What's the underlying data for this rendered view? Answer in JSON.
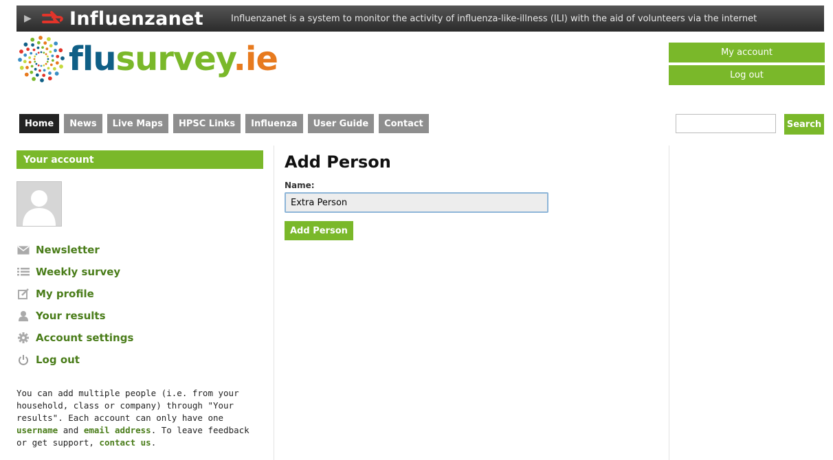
{
  "influenzanet_bar": {
    "title": "Influenzanet",
    "tagline": "Influenzanet is a system to monitor the activity of influenza-like-illness (ILI) with the aid of volunteers via the internet"
  },
  "logo": {
    "part1": "flu",
    "part2": "survey",
    "part3": ".ie"
  },
  "account_buttons": {
    "my_account": "My account",
    "log_out": "Log out"
  },
  "nav": {
    "items": [
      "Home",
      "News",
      "Live Maps",
      "HPSC Links",
      "Influenza",
      "User Guide",
      "Contact"
    ],
    "active": "Home"
  },
  "search": {
    "value": "",
    "button": "Search"
  },
  "sidebar": {
    "header": "Your account",
    "menu": [
      {
        "icon": "envelope-icon",
        "label": "Newsletter"
      },
      {
        "icon": "list-icon",
        "label": "Weekly survey"
      },
      {
        "icon": "edit-icon",
        "label": "My profile"
      },
      {
        "icon": "user-icon",
        "label": "Your results"
      },
      {
        "icon": "gear-icon",
        "label": "Account settings"
      },
      {
        "icon": "power-icon",
        "label": "Log out"
      }
    ],
    "info": {
      "text1": "You can add multiple people (i.e. from your household, class or company) through \"Your results\". Each account can only have one ",
      "link_username": "username",
      "text2": " and ",
      "link_email": "email address",
      "text3": ". To leave feedback or get support, ",
      "link_contact": "contact us",
      "text4": "."
    }
  },
  "main": {
    "title": "Add Person",
    "name_label": "Name:",
    "name_value": "Extra Person",
    "submit": "Add Person"
  },
  "colors": {
    "green": "#7ab82a",
    "dark_green": "#4a7d1a",
    "blue": "#0f5f86",
    "orange": "#e77a1e",
    "nav_gray": "#8e8e8e"
  }
}
